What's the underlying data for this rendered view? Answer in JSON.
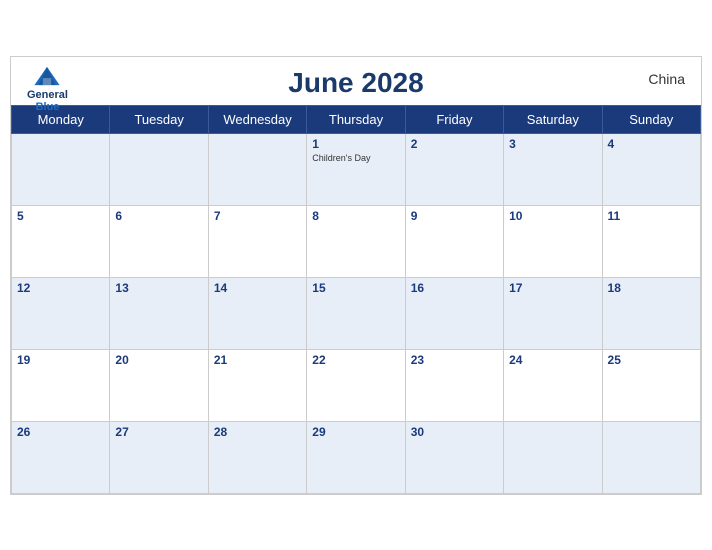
{
  "calendar": {
    "title": "June 2028",
    "country": "China",
    "logo": {
      "line1": "General",
      "line2": "Blue"
    },
    "days_of_week": [
      "Monday",
      "Tuesday",
      "Wednesday",
      "Thursday",
      "Friday",
      "Saturday",
      "Sunday"
    ],
    "weeks": [
      [
        {
          "day": "",
          "empty": true
        },
        {
          "day": "",
          "empty": true
        },
        {
          "day": "",
          "empty": true
        },
        {
          "day": "1",
          "event": "Children's Day"
        },
        {
          "day": "2"
        },
        {
          "day": "3"
        },
        {
          "day": "4"
        }
      ],
      [
        {
          "day": "5"
        },
        {
          "day": "6"
        },
        {
          "day": "7"
        },
        {
          "day": "8"
        },
        {
          "day": "9"
        },
        {
          "day": "10"
        },
        {
          "day": "11"
        }
      ],
      [
        {
          "day": "12"
        },
        {
          "day": "13"
        },
        {
          "day": "14"
        },
        {
          "day": "15"
        },
        {
          "day": "16"
        },
        {
          "day": "17"
        },
        {
          "day": "18"
        }
      ],
      [
        {
          "day": "19"
        },
        {
          "day": "20"
        },
        {
          "day": "21"
        },
        {
          "day": "22"
        },
        {
          "day": "23"
        },
        {
          "day": "24"
        },
        {
          "day": "25"
        }
      ],
      [
        {
          "day": "26"
        },
        {
          "day": "27"
        },
        {
          "day": "28"
        },
        {
          "day": "29"
        },
        {
          "day": "30"
        },
        {
          "day": "",
          "empty": true
        },
        {
          "day": "",
          "empty": true
        }
      ]
    ]
  }
}
